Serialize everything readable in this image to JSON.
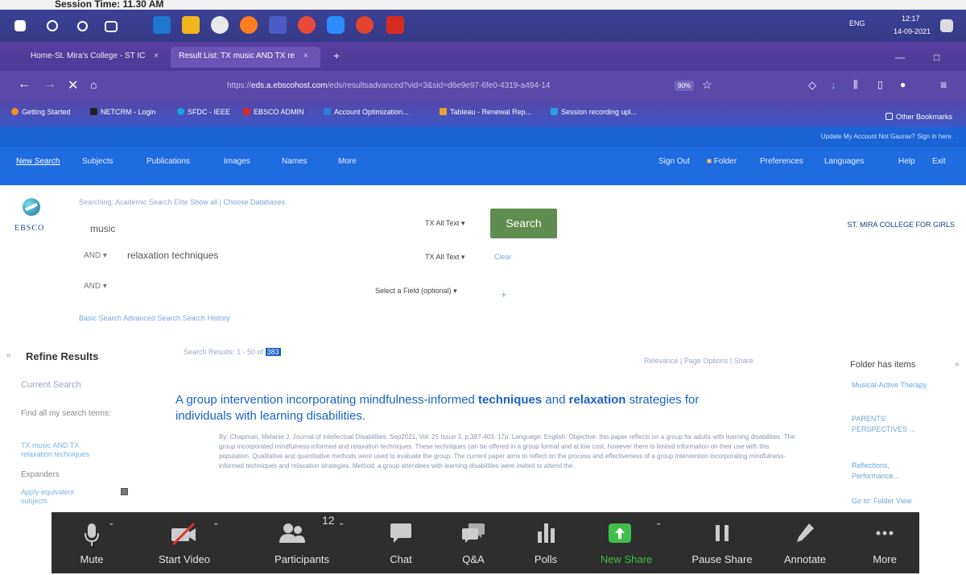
{
  "session": {
    "text": "Session Time: 11.30 AM"
  },
  "taskbar": {
    "lang": "ENG",
    "time": "12:17",
    "date": "14-09-2021"
  },
  "tabs": [
    {
      "label": "Home-St. Mira's College - ST IC",
      "close": "×"
    },
    {
      "label": "Result List: TX music AND TX re",
      "close": "×"
    }
  ],
  "browser": {
    "url_prefix": "https://",
    "url_domain": "eds.a.ebscohost.com",
    "url_rest": "/eds/resultsadvanced?vid=3&sid=d6e9e97-6fe0-4319-a494-14",
    "zoom": "90%"
  },
  "bookmarks": [
    {
      "label": "Getting Started",
      "color": "#f29025"
    },
    {
      "label": "NETCRM - Login",
      "color": "#222"
    },
    {
      "label": "SFDC - IEEE",
      "color": "#16a6e0"
    },
    {
      "label": "EBSCO ADMIN",
      "color": "#d42b2b"
    },
    {
      "label": "Account Optimization...",
      "color": "#2a7fd6"
    },
    {
      "label": "Tableau - Renewal Rep...",
      "color": "#e8a430"
    },
    {
      "label": "Session recording upl...",
      "color": "#2a9de0"
    }
  ],
  "other_bookmarks": "Other Bookmarks",
  "ebsco": {
    "account_text": "Update My Account   Not Gaurav?  Sign in here.",
    "nav_left": [
      "New Search",
      "Subjects",
      "Publications",
      "Images",
      "Names",
      "More"
    ],
    "nav_right": [
      "Sign Out",
      "Folder",
      "Preferences",
      "Languages",
      "Help",
      "Exit"
    ],
    "searching": "Searching: Academic Search Elite",
    "show_all": "Show all",
    "choose_db": "Choose Databases",
    "rows": [
      {
        "op": "",
        "term": "music",
        "field": "TX All Text"
      },
      {
        "op": "AND",
        "term": "relaxation techniques",
        "field": "TX All Text"
      },
      {
        "op": "AND",
        "term": "",
        "field": "Select a Field (optional)"
      }
    ],
    "search_button": "Search",
    "clear": "Clear",
    "plus": "+",
    "basic_search": "Basic Search   Advanced Search   Search History",
    "college": "ST. MIRA COLLEGE FOR GIRLS",
    "logo_text": "EBSCO"
  },
  "results": {
    "refine_heading": "Refine Results",
    "current_search": "Current Search",
    "find_all": "Find all my search terms:",
    "search_terms": "TX music AND TX relaxation techniques",
    "expanders": "Expanders",
    "apply_equivalent": "Apply equivalent subjects",
    "results_count_label": "Search Results: 1 - 50 of",
    "results_count": "383",
    "sort_options": "Relevance  |  Page Options  |  Share",
    "title_part1": "A group intervention incorporating mindfulness-informed ",
    "title_kw1": "techniques",
    "title_part2": " and ",
    "title_kw2": "relaxation",
    "title_part3": " strategies for individuals with learning disabilities.",
    "abstract": "By: Chapman, Melanie J. Journal of Intellectual Disabilities. Sep2021, Vol. 25 Issue 3, p.387-403. 17p. Language: English. Objective: this paper reflects on a group for adults with learning disabilities. The group incorporated mindfulness-informed and relaxation techniques. These techniques can be offered in a group format and at low cost, however there is limited information on their use with this population. Qualitative and quantitative methods were used to evaluate the group. The current paper aims to reflect on the process and effectiveness of a group intervention incorporating mindfulness-informed techniques and relaxation strategies. Method: a group attendees with learning disabilities were invited to attend the",
    "folder_heading": "Folder has items",
    "folder_items": [
      "Musical-Active Therapy",
      "PARENTS' PERSPECTIVES ...",
      "Reflections, Performance...",
      "Go to: Folder View"
    ]
  },
  "zoom": {
    "buttons": [
      {
        "label": "Mute",
        "icon": "microphone-icon"
      },
      {
        "label": "Start Video",
        "icon": "camera-off-icon"
      },
      {
        "label": "Participants",
        "icon": "participants-icon",
        "count": "12"
      },
      {
        "label": "Chat",
        "icon": "chat-icon"
      },
      {
        "label": "Q&A",
        "icon": "qa-icon"
      },
      {
        "label": "Polls",
        "icon": "polls-icon"
      },
      {
        "label": "New Share",
        "icon": "share-icon"
      },
      {
        "label": "Pause Share",
        "icon": "pause-icon"
      },
      {
        "label": "Annotate",
        "icon": "pen-icon"
      },
      {
        "label": "More",
        "icon": "more-icon"
      }
    ],
    "colors": {
      "share_green": "#3fbf4a",
      "bar_bg": "#2e2e2e"
    }
  }
}
